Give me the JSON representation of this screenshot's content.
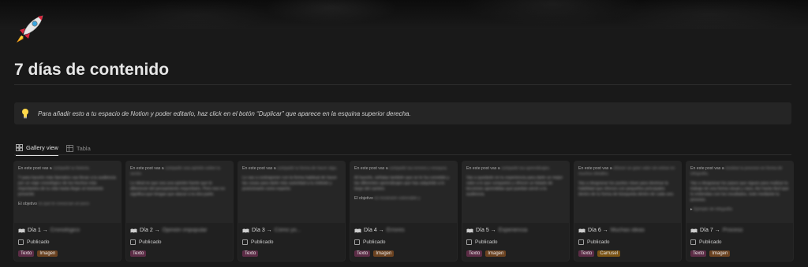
{
  "page": {
    "title": "7 días de contenido",
    "icon": "rocket-icon"
  },
  "callout": {
    "icon": "lightbulb-icon",
    "text": "Para añadir esto a tu espacio de Notion y poder editarlo, haz click en el botón “Duplicar” que aparece en la esquina superior derecha."
  },
  "tabs": [
    {
      "label": "Gallery view",
      "icon": "gallery-icon",
      "active": true
    },
    {
      "label": "Tabla",
      "icon": "table-icon",
      "active": false
    }
  ],
  "colors": {
    "background": "#191919",
    "card": "#202020",
    "tag_texto": "#5c2c46",
    "tag_imagen": "#6b4220",
    "tag_carrusel": "#7a5314"
  },
  "checkbox_label": "Publicado",
  "cards": [
    {
      "intro": "En este post vas a",
      "intro_blur": "compartir tu historia.",
      "p2_blur": "Y para hacerlo más llamativo vas llevar a tu audiencia por un viaje cronológico de los hechos más importantes de tu vida hasta llegar al momento presente.",
      "p3": "El objetivo",
      "p3_blur": "es que te conozcan un poco",
      "day": "Día 1 →",
      "name_blur": "Cronológico",
      "tags": [
        {
          "label": "Texto",
          "color": "#5c2c46"
        },
        {
          "label": "Imagen",
          "color": "#6b4220"
        }
      ]
    },
    {
      "intro": "En este post vas a",
      "intro_blur": "compartir una opinión sobre tu sector.",
      "p2_blur": "Lo ideal es que sea una opinión fuerte que te diferencie del pensamiento mayoritario. Pero eso no significa que tengas que atacar a la otra parte.",
      "p3": "",
      "p3_blur": "",
      "day": "Día 2 →",
      "name_blur": "Opinión impopular",
      "tags": [
        {
          "label": "Texto",
          "color": "#5c2c46"
        }
      ]
    },
    {
      "intro": "En este post vas a",
      "intro_blur": "compartir tu forma de hacer algo.",
      "p2_blur": "Lo vas a contraponer con la forma habitual de hacer las cosas para darle más autoridad a tu método y posicionarte como experto.",
      "p3": "",
      "p3_blur": "",
      "day": "Día 3 →",
      "name_blur": "Cómo yo...",
      "tags": [
        {
          "label": "Texto",
          "color": "#5c2c46"
        }
      ]
    },
    {
      "intro": "En este post vas a",
      "intro_blur": "compartir tus errores y ",
      "intro_tail": "ensayos.",
      "p2_blur": "Al hacerlo, señalas también que se te ha cometido y las diferentes aprendizajes que has adquirido a lo largo del camino.",
      "p3": "El objetivo",
      "p3_blur": "es mostrarte vulnerable y",
      "day": "Día 4 →",
      "name_blur": "Errores",
      "tags": [
        {
          "label": "Texto",
          "color": "#5c2c46"
        },
        {
          "label": "Imagen",
          "color": "#6b4220"
        }
      ]
    },
    {
      "intro": "En este post vas a",
      "intro_blur": "compartir tus aprendizajes.",
      "p2_blur": "Vas a quedarte en tu experiencia para darle un mejor valor a lo que compartes y ofrecer un listado de lecciones aprendidas que puedan servir a tu audiencia.",
      "p3": "",
      "p3_blur": "",
      "day": "Día 5 →",
      "name_blur": "Experiencia",
      "tags": [
        {
          "label": "Texto",
          "color": "#5c2c46"
        },
        {
          "label": "Imagen",
          "color": "#6b4220"
        }
      ]
    },
    {
      "intro": "En este post vas a",
      "intro_blur": "ofrecer un gran valor sin entrar en muchos detalles.",
      "p2_blur": "Vas a desgranar los puntos clave para dominar la habilidad que ofreces con pequeños principales dentro de tu forma de búsqueda dentro de cada uno.",
      "p3": "",
      "p3_blur": "",
      "day": "Día 6 →",
      "name_blur": "Muchas ideas",
      "tags": [
        {
          "label": "Texto",
          "color": "#5c2c46"
        },
        {
          "label": "Carrusel",
          "color": "#7a5314"
        }
      ]
    },
    {
      "intro": "En este post vas a",
      "intro_blur": "mostrar tu proceso en forma de infografía.",
      "p2_blur": "Vas a desgranar los pasos que sigues para realizar tu trabajo de una forma visual y clara. Así harás fácil que lo entiendas con los resultados, todo mediante tu proceso.",
      "p3": "",
      "p3_blur": "Ejemplo de infografía",
      "day": "Día 7 →",
      "name_blur": "Proceso",
      "tags": [
        {
          "label": "Texto",
          "color": "#5c2c46"
        },
        {
          "label": "Imagen",
          "color": "#6b4220"
        }
      ]
    }
  ]
}
